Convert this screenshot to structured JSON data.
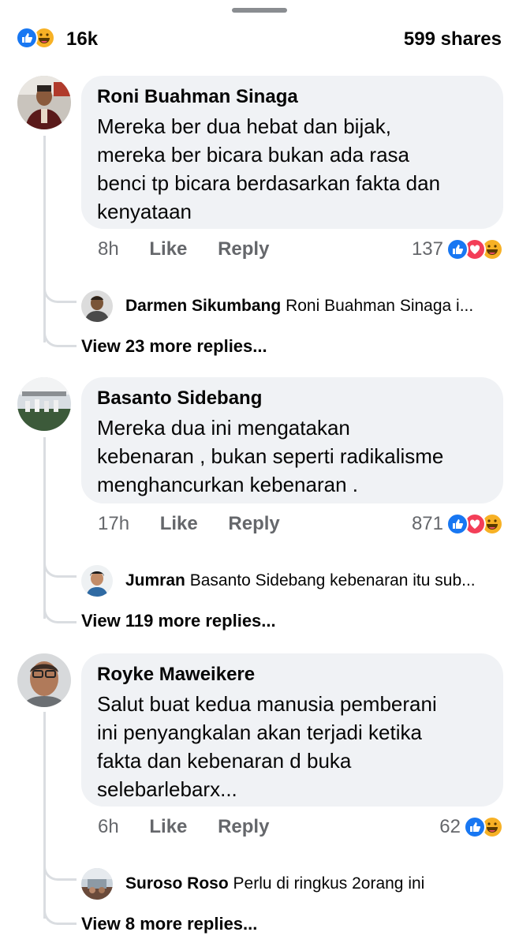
{
  "summary": {
    "reaction_count": "16k",
    "shares": "599 shares",
    "icons": [
      "like-icon",
      "haha-icon"
    ]
  },
  "comments": [
    {
      "name": "Roni Buahman Sinaga",
      "lines": [
        "Mereka ber dua hebat dan bijak,",
        "mereka ber bicara bukan ada rasa",
        "benci tp bicara berdasarkan fakta dan",
        "kenyataan"
      ],
      "time": "8h",
      "like": "Like",
      "reply": "Reply",
      "reactions": "137",
      "reaction_icons": [
        "like-icon",
        "love-icon",
        "haha-icon"
      ],
      "reply_preview": {
        "name": "Darmen Sikumbang",
        "text": "Roni Buahman Sinaga i..."
      },
      "more": "View 23 more replies..."
    },
    {
      "name": "Basanto Sidebang",
      "lines": [
        "Mereka dua ini mengatakan",
        "kebenaran , bukan seperti radikalisme",
        "menghancurkan kebenaran ."
      ],
      "time": "17h",
      "like": "Like",
      "reply": "Reply",
      "reactions": "871",
      "reaction_icons": [
        "like-icon",
        "love-icon",
        "haha-icon"
      ],
      "reply_preview": {
        "name": "Jumran",
        "text": "Basanto Sidebang kebenaran itu sub..."
      },
      "more": "View 119 more replies..."
    },
    {
      "name": "Royke Maweikere",
      "lines": [
        "Salut buat kedua manusia pemberani",
        "ini penyangkalan akan terjadi ketika",
        "fakta dan kebenaran d buka",
        "selebarlebarx..."
      ],
      "time": "6h",
      "like": "Like",
      "reply": "Reply",
      "reactions": "62",
      "reaction_icons": [
        "like-icon",
        "haha-icon"
      ],
      "reply_preview": {
        "name": "Suroso Roso",
        "text": "Perlu di ringkus 2orang ini"
      },
      "more": "View 8 more replies..."
    }
  ],
  "colors": {
    "like": "#1877f2",
    "love": "#f33e58",
    "haha": "#f7b125",
    "bubble": "#f0f2f5",
    "meta": "#65676b"
  }
}
